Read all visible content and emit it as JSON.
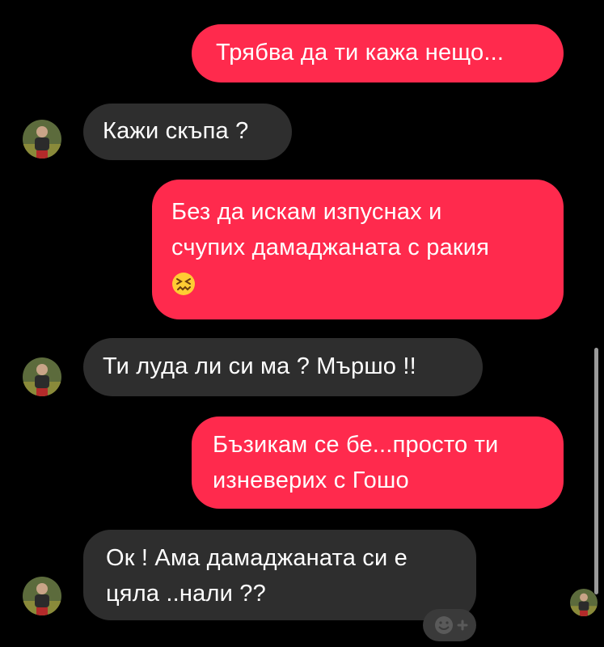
{
  "messages": [
    {
      "side": "outgoing",
      "lines": [
        "Трябва да ти кажа нещо..."
      ]
    },
    {
      "side": "incoming",
      "lines": [
        "Кажи скъпа ?"
      ]
    },
    {
      "side": "outgoing",
      "lines": [
        "Без да искам изпуснах и",
        "счупих дамаджаната с ракия"
      ],
      "emoji": "confounded-face"
    },
    {
      "side": "incoming",
      "lines": [
        "Ти луда ли си ма ? Мършо !!"
      ]
    },
    {
      "side": "outgoing",
      "lines": [
        "Бъзикам се бе...просто ти",
        "изневерих с Гошо"
      ]
    },
    {
      "side": "incoming",
      "lines": [
        "Ок ! Ама дамаджаната си е",
        "цяла ..нали ??"
      ]
    }
  ],
  "colors": {
    "background": "#000000",
    "outgoing_bubble": "#ff2a4d",
    "incoming_bubble": "#2e2e2e",
    "text": "#ffffff"
  },
  "icons": {
    "reaction_button": "add-reaction-icon",
    "avatar": "contact-avatar"
  }
}
